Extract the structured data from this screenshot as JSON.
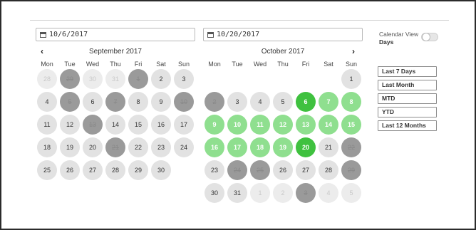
{
  "start_date": {
    "value": "10/6/2017"
  },
  "end_date": {
    "value": "10/20/2017"
  },
  "weekdays": [
    "Mon",
    "Tue",
    "Wed",
    "Thu",
    "Fri",
    "Sat",
    "Sun"
  ],
  "left_calendar": {
    "month": "September 2017",
    "prev_icon": "chevron-left-icon",
    "days": [
      {
        "n": "28",
        "s": "dim"
      },
      {
        "n": "29",
        "s": "blocked"
      },
      {
        "n": "30",
        "s": "dim"
      },
      {
        "n": "31",
        "s": "dim"
      },
      {
        "n": "1",
        "s": "blocked"
      },
      {
        "n": "2",
        "s": "avail"
      },
      {
        "n": "3",
        "s": "avail"
      },
      {
        "n": "4",
        "s": "avail"
      },
      {
        "n": "5",
        "s": "blocked"
      },
      {
        "n": "6",
        "s": "avail"
      },
      {
        "n": "7",
        "s": "blocked"
      },
      {
        "n": "8",
        "s": "avail"
      },
      {
        "n": "9",
        "s": "avail"
      },
      {
        "n": "10",
        "s": "blocked"
      },
      {
        "n": "11",
        "s": "avail"
      },
      {
        "n": "12",
        "s": "avail"
      },
      {
        "n": "13",
        "s": "blocked"
      },
      {
        "n": "14",
        "s": "avail"
      },
      {
        "n": "15",
        "s": "avail"
      },
      {
        "n": "16",
        "s": "avail"
      },
      {
        "n": "17",
        "s": "avail"
      },
      {
        "n": "18",
        "s": "avail"
      },
      {
        "n": "19",
        "s": "avail"
      },
      {
        "n": "20",
        "s": "avail"
      },
      {
        "n": "21",
        "s": "blocked"
      },
      {
        "n": "22",
        "s": "avail"
      },
      {
        "n": "23",
        "s": "avail"
      },
      {
        "n": "24",
        "s": "avail"
      },
      {
        "n": "25",
        "s": "avail"
      },
      {
        "n": "26",
        "s": "avail"
      },
      {
        "n": "27",
        "s": "avail"
      },
      {
        "n": "28",
        "s": "avail"
      },
      {
        "n": "29",
        "s": "avail"
      },
      {
        "n": "30",
        "s": "avail"
      }
    ]
  },
  "right_calendar": {
    "month": "October 2017",
    "next_icon": "chevron-right-icon",
    "leading_blank": 6,
    "days": [
      {
        "n": "1",
        "s": "avail"
      },
      {
        "n": "2",
        "s": "blocked"
      },
      {
        "n": "3",
        "s": "avail"
      },
      {
        "n": "4",
        "s": "avail"
      },
      {
        "n": "5",
        "s": "avail"
      },
      {
        "n": "6",
        "s": "end"
      },
      {
        "n": "7",
        "s": "sel"
      },
      {
        "n": "8",
        "s": "sel"
      },
      {
        "n": "9",
        "s": "sel"
      },
      {
        "n": "10",
        "s": "sel"
      },
      {
        "n": "11",
        "s": "sel"
      },
      {
        "n": "12",
        "s": "sel"
      },
      {
        "n": "13",
        "s": "sel"
      },
      {
        "n": "14",
        "s": "sel"
      },
      {
        "n": "15",
        "s": "sel"
      },
      {
        "n": "16",
        "s": "sel"
      },
      {
        "n": "17",
        "s": "sel"
      },
      {
        "n": "18",
        "s": "sel"
      },
      {
        "n": "19",
        "s": "sel"
      },
      {
        "n": "20",
        "s": "end"
      },
      {
        "n": "21",
        "s": "avail"
      },
      {
        "n": "22",
        "s": "blocked"
      },
      {
        "n": "23",
        "s": "avail"
      },
      {
        "n": "24",
        "s": "blocked"
      },
      {
        "n": "25",
        "s": "blocked"
      },
      {
        "n": "26",
        "s": "avail"
      },
      {
        "n": "27",
        "s": "avail"
      },
      {
        "n": "28",
        "s": "avail"
      },
      {
        "n": "29",
        "s": "blocked"
      },
      {
        "n": "30",
        "s": "avail"
      },
      {
        "n": "31",
        "s": "avail"
      },
      {
        "n": "1",
        "s": "dim"
      },
      {
        "n": "2",
        "s": "dim"
      },
      {
        "n": "3",
        "s": "blocked"
      },
      {
        "n": "4",
        "s": "dim"
      },
      {
        "n": "5",
        "s": "dim"
      }
    ]
  },
  "calendar_view": {
    "label": "Calendar View",
    "value": "Days",
    "toggle_on": false
  },
  "range_buttons": [
    "Last 7 Days",
    "Last Month",
    "MTD",
    "YTD",
    "Last 12 Months"
  ],
  "colors": {
    "selected": "#8fdf8f",
    "range_end": "#3fc13f",
    "available": "#e2e2e2",
    "unavailable": "#9a9a9a"
  }
}
